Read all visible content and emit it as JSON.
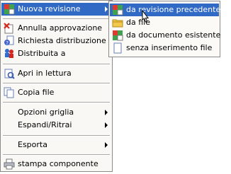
{
  "main_menu": {
    "items": [
      {
        "label": "Nuova revisione",
        "icon": "revision-icon",
        "has_submenu": true,
        "selected": true
      },
      {
        "label": "Annulla approvazione",
        "icon": "cancel-approval-icon"
      },
      {
        "label": "Richiesta distribuzione",
        "icon": "distribution-request-icon"
      },
      {
        "label": "Distribuita a",
        "icon": "distributed-to-icon"
      },
      {
        "label": "Apri in lettura",
        "icon": "open-read-icon"
      },
      {
        "label": "Copia file",
        "icon": "copy-file-icon"
      },
      {
        "label": "Opzioni griglia",
        "has_submenu": true
      },
      {
        "label": "Espandi/Ritrai",
        "has_submenu": true
      },
      {
        "label": "Esporta",
        "has_submenu": true
      },
      {
        "label": "stampa componente",
        "icon": "print-icon"
      }
    ]
  },
  "sub_menu": {
    "items": [
      {
        "label": "da revisione precedente",
        "icon": "previous-revision-icon",
        "selected": true
      },
      {
        "label": "da file",
        "icon": "folder-icon"
      },
      {
        "label": "da documento esistente",
        "icon": "existing-document-icon"
      },
      {
        "label": "senza inserimento file",
        "icon": "blank-document-icon"
      }
    ]
  },
  "colors": {
    "highlight": "#316ac5",
    "menu_bg": "#f9f8f4"
  }
}
